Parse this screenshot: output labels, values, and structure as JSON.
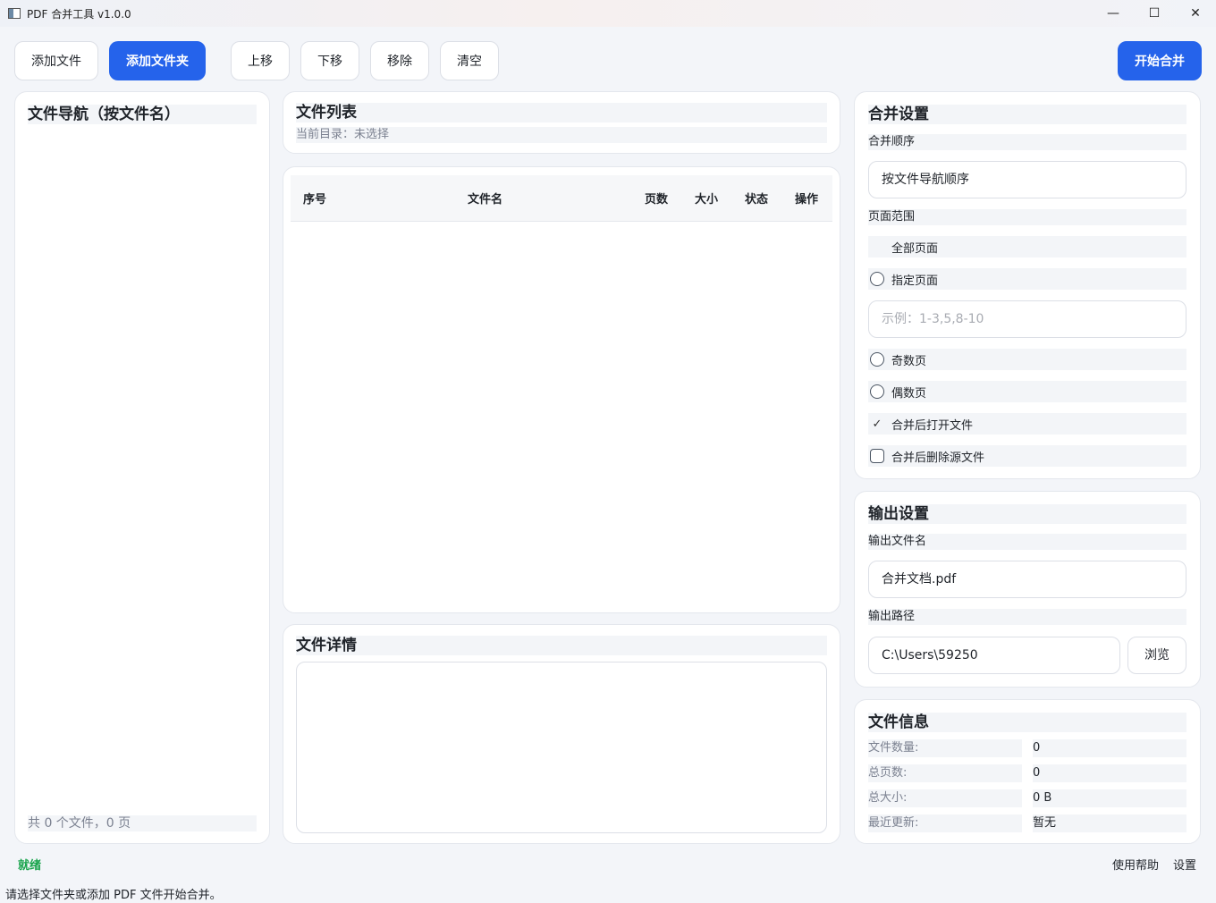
{
  "window": {
    "title": "PDF 合并工具 v1.0.0",
    "minimize": "—",
    "maximize": "☐",
    "close": "✕"
  },
  "toolbar": {
    "add_file": "添加文件",
    "add_folder": "添加文件夹",
    "move_up": "上移",
    "move_down": "下移",
    "remove": "移除",
    "clear": "清空",
    "start_merge": "开始合并"
  },
  "nav_panel": {
    "title": "文件导航（按文件名）",
    "footer": "共 0 个文件，0 页"
  },
  "file_list_header": {
    "title": "文件列表",
    "current_dir": "当前目录：未选择"
  },
  "table": {
    "columns": [
      "序号",
      "文件名",
      "页数",
      "大小",
      "状态",
      "操作"
    ],
    "rows": []
  },
  "details": {
    "title": "文件详情",
    "content": ""
  },
  "merge_settings": {
    "title": "合并设置",
    "order_label": "合并顺序",
    "order_value": "按文件导航顺序",
    "range_label": "页面范围",
    "range_all": "全部页面",
    "range_specific": "指定页面",
    "range_placeholder": "示例：1-3,5,8-10",
    "range_odd": "奇数页",
    "range_even": "偶数页",
    "open_after": "合并后打开文件",
    "delete_after": "合并后删除源文件"
  },
  "output_settings": {
    "title": "输出设置",
    "filename_label": "输出文件名",
    "filename_value": "合并文档.pdf",
    "path_label": "输出路径",
    "path_value": "C:\\Users\\59250",
    "browse": "浏览"
  },
  "file_info": {
    "title": "文件信息",
    "count_label": "文件数量:",
    "count_value": "0",
    "pages_label": "总页数:",
    "pages_value": "0",
    "size_label": "总大小:",
    "size_value": "0 B",
    "updated_label": "最近更新:",
    "updated_value": "暂无"
  },
  "status": {
    "state": "就绪",
    "message": "请选择文件夹或添加 PDF 文件开始合并。",
    "help": "使用帮助",
    "settings": "设置"
  },
  "colors": {
    "accent": "#2563eb",
    "ready": "#16a34a"
  }
}
